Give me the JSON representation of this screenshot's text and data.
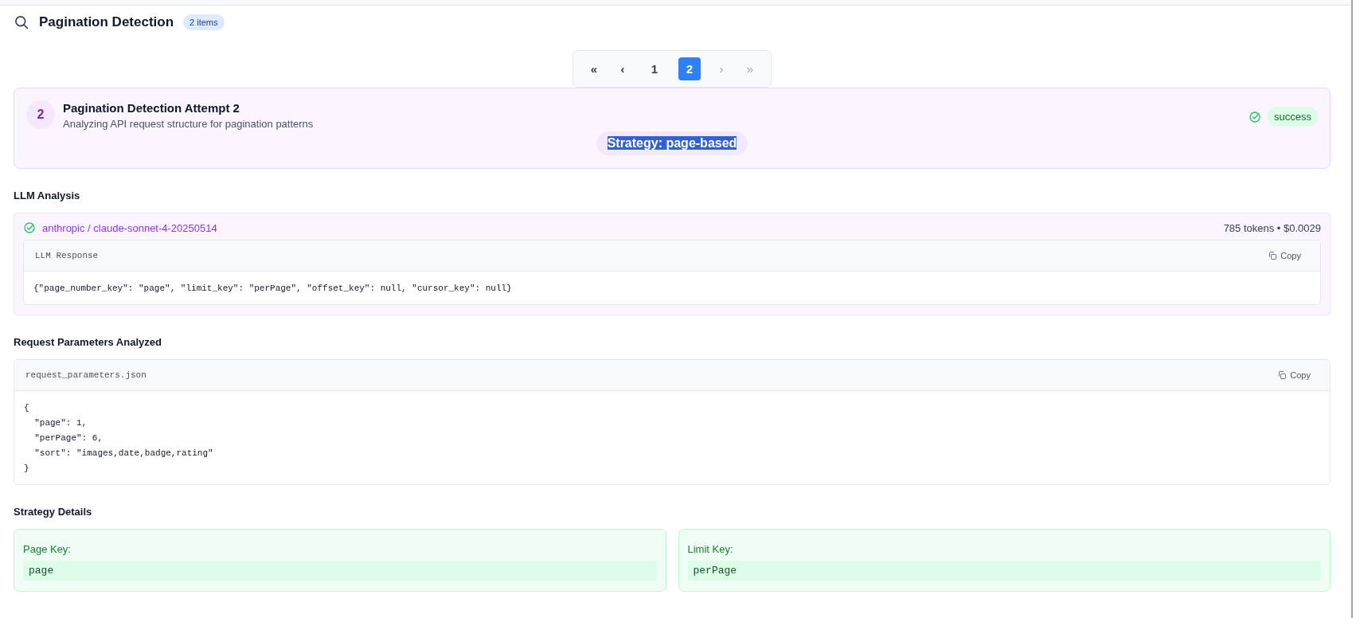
{
  "header": {
    "title": "Pagination Detection",
    "count_badge": "2 items"
  },
  "pagination": [
    {
      "kind": "first",
      "label": "«",
      "disabled": false,
      "selected": false
    },
    {
      "kind": "prev",
      "label": "‹",
      "disabled": false,
      "selected": false
    },
    {
      "kind": "page",
      "label": "1",
      "disabled": false,
      "selected": false
    },
    {
      "kind": "page",
      "label": "2",
      "disabled": false,
      "selected": true
    },
    {
      "kind": "next",
      "label": "›",
      "disabled": true,
      "selected": false
    },
    {
      "kind": "last",
      "label": "»",
      "disabled": true,
      "selected": false
    }
  ],
  "attempt": {
    "number": "2",
    "title": "Pagination Detection Attempt 2",
    "subtitle": "Analyzing API request structure for pagination patterns",
    "status": "success",
    "strategy": {
      "label": "Strategy: page-based",
      "selected": true
    }
  },
  "llm_analysis": {
    "heading": "LLM Analysis",
    "model": "anthropic / claude-sonnet-4-20250514",
    "usage": "785 tokens • $0.0029",
    "response": {
      "title": "LLM Response",
      "copy_label": "Copy",
      "lines": [
        "{\"page_number_key\": \"page\", \"limit_key\": \"perPage\", \"offset_key\": null, \"cursor_key\": null}"
      ]
    }
  },
  "request_parameters": {
    "heading": "Request Parameters Analyzed",
    "file": {
      "title": "request_parameters.json",
      "copy_label": "Copy",
      "lines": [
        "{",
        "  \"page\": 1,",
        "  \"perPage\": 6,",
        "  \"sort\": \"images,date,badge,rating\"",
        "}"
      ]
    }
  },
  "strategy_details": {
    "heading": "Strategy Details",
    "items": [
      {
        "label": "Page Key:",
        "value": "page"
      },
      {
        "label": "Limit Key:",
        "value": "perPage"
      }
    ]
  }
}
